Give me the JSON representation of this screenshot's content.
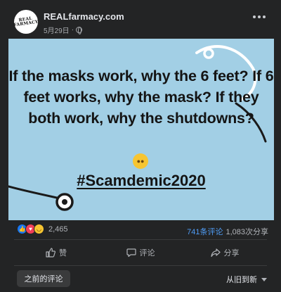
{
  "header": {
    "avatar_text": "REAL FARMACY",
    "page_name": "REALfarmacy.com",
    "date": "5月29日"
  },
  "post": {
    "image_text": "If the masks work, why the 6 feet? If 6 feet works, why the mask? If they both work, why the shutdowns?",
    "emoji": "thinking-face",
    "hashtag": "#Scamdemic2020",
    "background_color": "#a2cfe5"
  },
  "reactions": {
    "count": "2,465",
    "comments": "741条评论",
    "shares": "1,083次分享"
  },
  "actions": {
    "like": "赞",
    "comment": "评论",
    "share": "分享"
  },
  "comments_bar": {
    "previous": "之前的评论",
    "sort": "从旧到新"
  },
  "colors": {
    "accent": "#1877f2",
    "love": "#f33e58",
    "haha": "#f7c531",
    "card_bg": "#232425"
  }
}
